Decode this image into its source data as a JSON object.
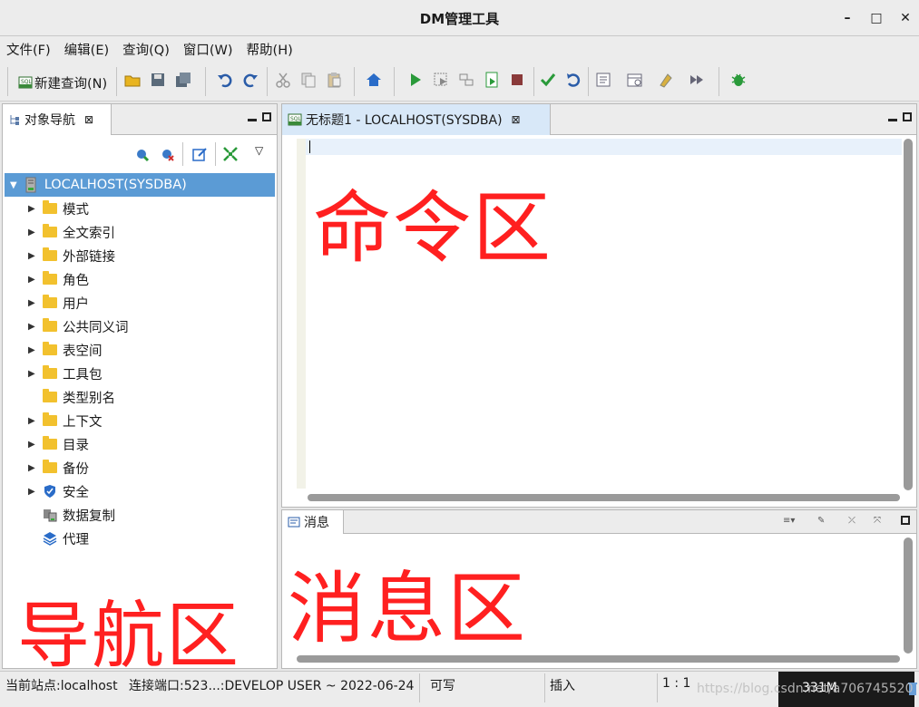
{
  "window": {
    "title": "DM管理工具",
    "controls": {
      "minimize": "–",
      "maximize": "□",
      "close": "✕"
    }
  },
  "menu": [
    {
      "label": "文件(F)"
    },
    {
      "label": "编辑(E)"
    },
    {
      "label": "查询(Q)"
    },
    {
      "label": "窗口(W)"
    },
    {
      "label": "帮助(H)"
    }
  ],
  "toolbar": {
    "new_query_label": "新建查询(N)",
    "icons": [
      "sql-icon",
      "open-folder-icon",
      "save-icon",
      "save-all-icon",
      "undo-icon",
      "redo-icon",
      "cut-icon",
      "copy-icon",
      "paste-icon",
      "home-icon",
      "run-icon",
      "run-step-icon",
      "explain-icon",
      "run-script-icon",
      "stop-icon",
      "commit-icon",
      "rollback-icon",
      "query-plan-icon",
      "schedule-icon",
      "format-icon",
      "next-step-icon",
      "debug-icon"
    ]
  },
  "navigator": {
    "tab_label": "对象导航",
    "tab_close": "⊠",
    "root_label": "LOCALHOST(SYSDBA)",
    "items": [
      {
        "label": "模式",
        "expandable": true
      },
      {
        "label": "全文索引",
        "expandable": true
      },
      {
        "label": "外部链接",
        "expandable": true
      },
      {
        "label": "角色",
        "expandable": true
      },
      {
        "label": "用户",
        "expandable": true
      },
      {
        "label": "公共同义词",
        "expandable": true
      },
      {
        "label": "表空间",
        "expandable": true
      },
      {
        "label": "工具包",
        "expandable": true
      },
      {
        "label": "类型别名",
        "expandable": false
      },
      {
        "label": "上下文",
        "expandable": true
      },
      {
        "label": "目录",
        "expandable": true
      },
      {
        "label": "备份",
        "expandable": true
      },
      {
        "label": "安全",
        "expandable": true
      },
      {
        "label": "数据复制",
        "expandable": false
      },
      {
        "label": "代理",
        "expandable": false
      }
    ],
    "annotation": "导航区"
  },
  "editor": {
    "tab_label": "无标题1 - LOCALHOST(SYSDBA)",
    "tab_close": "⊠",
    "annotation": "命令区"
  },
  "messages": {
    "tab_label": "消息",
    "annotation": "消息区"
  },
  "status": {
    "site": "当前站点:localhost",
    "port": "连接端口:523...:DEVELOP USER ~ 2022-06-24",
    "writable": "可写",
    "insert_mode": "插入",
    "cursor_pos": "1 : 1",
    "memory": "331M"
  },
  "watermark": "https://blog.csdn.net/a706745520",
  "colors": {
    "annotation_red": "#ff2020",
    "selection_blue": "#5b9bd5",
    "folder_yellow": "#f2c12e"
  }
}
